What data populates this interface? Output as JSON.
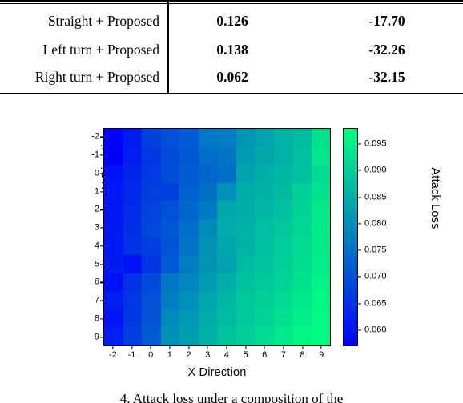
{
  "table": {
    "rows": [
      {
        "label": "Straight + Proposed",
        "value1": "0.126",
        "value2": "-17.70"
      },
      {
        "label": "Left turn + Proposed",
        "value1": "0.138",
        "value2": "-32.26"
      },
      {
        "label": "Right turn + Proposed",
        "value1": "0.062",
        "value2": "-32.15"
      }
    ]
  },
  "figure": {
    "xlabel": "X Direction",
    "ylabel": "Y Direction",
    "colorbar_label": "Attack Loss"
  },
  "caption": {
    "text": "4. Attack loss under a composition of the"
  },
  "chart_data": {
    "type": "heatmap",
    "title": "",
    "xlabel": "X Direction",
    "ylabel": "Y Direction",
    "colorbar_label": "Attack Loss",
    "colormap": "winter_reversed",
    "grid": false,
    "legend_position": "right",
    "x": [
      -2,
      -1,
      0,
      1,
      2,
      3,
      4,
      5,
      6,
      7,
      8,
      9
    ],
    "y": [
      -2,
      -1,
      0,
      1,
      2,
      3,
      4,
      5,
      6,
      7,
      8,
      9
    ],
    "xtick_labels": [
      "-2",
      "-1",
      "0",
      "1",
      "2",
      "3",
      "4",
      "5",
      "6",
      "7",
      "8",
      "9"
    ],
    "ytick_labels": [
      "-2",
      "-1",
      "0",
      "1",
      "2",
      "3",
      "4",
      "5",
      "6",
      "7",
      "8",
      "9"
    ],
    "colorbar_ticks": [
      0.06,
      0.065,
      0.07,
      0.075,
      0.08,
      0.085,
      0.09,
      0.095
    ],
    "colorbar_tick_labels": [
      "0.060",
      "0.065",
      "0.070",
      "0.075",
      "0.080",
      "0.085",
      "0.090",
      "0.095"
    ],
    "zlim": [
      0.057,
      0.098
    ],
    "colors": {
      "low": "#0000ff",
      "high": "#00ff80"
    },
    "values": [
      [
        0.0575,
        0.0615,
        0.0675,
        0.07,
        0.0715,
        0.076,
        0.077,
        0.081,
        0.083,
        0.0855,
        0.087,
        0.093
      ],
      [
        0.057,
        0.062,
        0.066,
        0.069,
        0.071,
        0.0745,
        0.0755,
        0.082,
        0.084,
        0.0855,
        0.0875,
        0.094
      ],
      [
        0.06,
        0.063,
        0.0665,
        0.0695,
        0.072,
        0.0735,
        0.075,
        0.083,
        0.085,
        0.0865,
        0.088,
        0.0925
      ],
      [
        0.0605,
        0.0635,
        0.067,
        0.0675,
        0.0725,
        0.075,
        0.08,
        0.0845,
        0.086,
        0.087,
        0.0905,
        0.0935
      ],
      [
        0.061,
        0.064,
        0.068,
        0.07,
        0.0735,
        0.0765,
        0.084,
        0.085,
        0.0865,
        0.088,
        0.091,
        0.0945
      ],
      [
        0.0612,
        0.0645,
        0.0685,
        0.071,
        0.0745,
        0.079,
        0.0845,
        0.0855,
        0.0875,
        0.089,
        0.0915,
        0.095
      ],
      [
        0.0608,
        0.065,
        0.0672,
        0.0705,
        0.0755,
        0.0805,
        0.0835,
        0.086,
        0.088,
        0.09,
        0.092,
        0.095
      ],
      [
        0.0615,
        0.06,
        0.0655,
        0.0715,
        0.077,
        0.081,
        0.083,
        0.087,
        0.0885,
        0.0905,
        0.0925,
        0.0955
      ],
      [
        0.0598,
        0.0648,
        0.069,
        0.076,
        0.0785,
        0.082,
        0.085,
        0.088,
        0.0895,
        0.091,
        0.0935,
        0.096
      ],
      [
        0.0618,
        0.0655,
        0.07,
        0.0775,
        0.08,
        0.0835,
        0.0865,
        0.089,
        0.0905,
        0.092,
        0.0945,
        0.0968
      ],
      [
        0.0602,
        0.066,
        0.0705,
        0.079,
        0.0815,
        0.0845,
        0.087,
        0.0895,
        0.091,
        0.093,
        0.0955,
        0.0972
      ],
      [
        0.062,
        0.0668,
        0.0715,
        0.0805,
        0.0825,
        0.0855,
        0.0885,
        0.09,
        0.092,
        0.0945,
        0.0965,
        0.0975
      ]
    ]
  }
}
